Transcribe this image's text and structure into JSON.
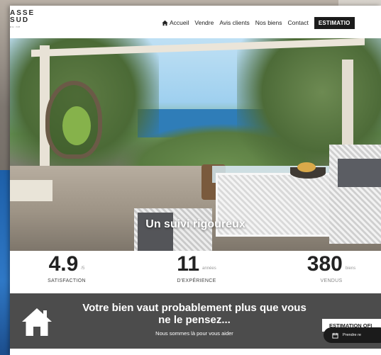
{
  "header": {
    "logo": {
      "line1": "ASSE",
      "line2": "SUD",
      "line3": "ou ne"
    },
    "nav": [
      {
        "label": "Accueil",
        "icon": "home-icon"
      },
      {
        "label": "Vendre"
      },
      {
        "label": "Avis clients"
      },
      {
        "label": "Nos biens"
      },
      {
        "label": "Contact"
      }
    ],
    "cta_label": "ESTIMATIO"
  },
  "hero": {
    "caption": "Un suivi rigoureux"
  },
  "stats": [
    {
      "value": "4.9",
      "unit": "/5",
      "label": "SATISFACTION"
    },
    {
      "value": "11",
      "unit": "années",
      "label": "D'EXPÉRIENCE"
    },
    {
      "value": "380",
      "unit": "biens",
      "label": "VENDUS"
    }
  ],
  "cta": {
    "title": "Votre bien vaut probablement plus que vous ne le pensez...",
    "subtitle": "Nous sommes là pour vous aider",
    "button_label": "ESTIMATION OFI",
    "rdv_label": "Prendre re"
  },
  "colors": {
    "cta_band": "#4c4c4c",
    "nav_cta_bg": "#1b1b1b",
    "left_blue": "#2f78c6"
  }
}
